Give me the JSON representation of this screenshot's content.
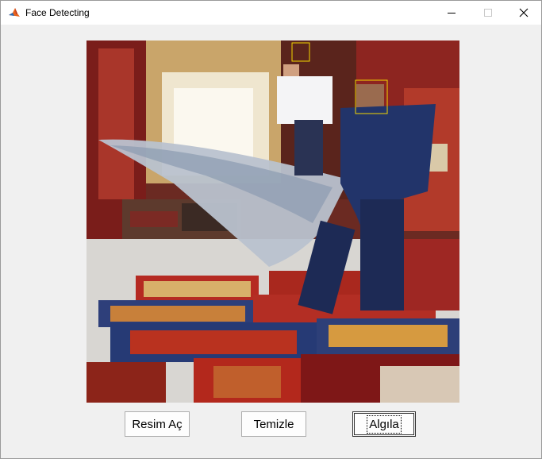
{
  "window": {
    "title": "Face Detecting",
    "icon": "matlab-icon",
    "controls": [
      "minimize-icon",
      "maximize-icon",
      "close-icon"
    ]
  },
  "image": {
    "description_icon": "carpet-shop-photo",
    "face_box_color": "#f2d600"
  },
  "buttons": {
    "open_label": "Resim Aç",
    "clear_label": "Temizle",
    "detect_label": "Algıla"
  }
}
